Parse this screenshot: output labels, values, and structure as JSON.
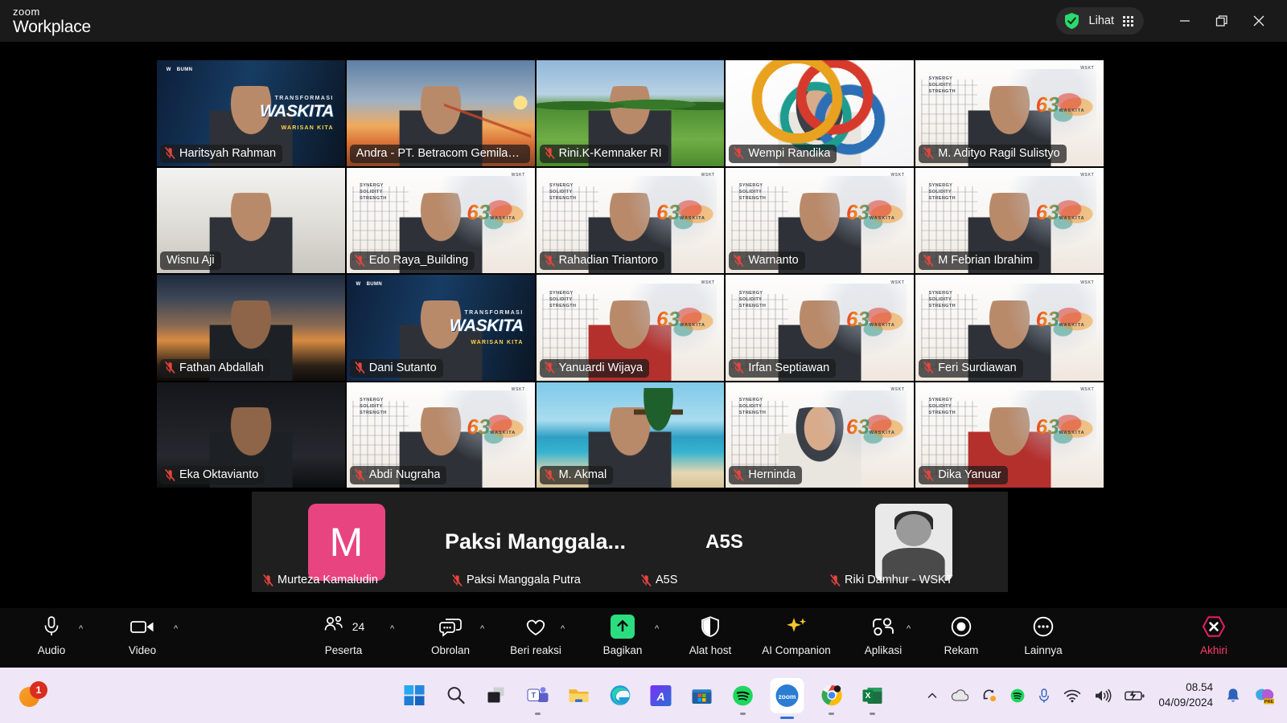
{
  "app": {
    "brand_top": "zoom",
    "brand_bottom": "Workplace"
  },
  "titlebar": {
    "view_label": "Lihat",
    "minimize_label": "—",
    "restore_label": "❐",
    "close_label": "✕"
  },
  "gallery": {
    "participants": [
      {
        "name": "Haritsyah Rahman",
        "muted": true,
        "bg": "bg-transformasi",
        "row": 1
      },
      {
        "name": "Andra - PT. Betracom Gemilang...",
        "muted": false,
        "bg": "bg-bridge",
        "row": 1,
        "active": true
      },
      {
        "name": "Rini.K-Kemnaker RI",
        "muted": true,
        "bg": "bg-field",
        "row": 1
      },
      {
        "name": "Wempi Randika",
        "muted": true,
        "bg": "bg-rings",
        "row": 1
      },
      {
        "name": "M. Adityo Ragil Sulistyo",
        "muted": true,
        "bg": "bg-waskita63",
        "row": 1
      },
      {
        "name": "Wisnu Aji",
        "muted": false,
        "bg": "bg-room",
        "row": 2
      },
      {
        "name": "Edo Raya_Building",
        "muted": true,
        "bg": "bg-waskita63",
        "row": 2
      },
      {
        "name": "Rahadian Triantoro",
        "muted": true,
        "bg": "bg-waskita63",
        "row": 2
      },
      {
        "name": "Warnanto",
        "muted": true,
        "bg": "bg-waskita63",
        "row": 2
      },
      {
        "name": "M Febrian Ibrahim",
        "muted": true,
        "bg": "bg-waskita63",
        "row": 2
      },
      {
        "name": "Fathan Abdallah",
        "muted": true,
        "bg": "bg-sunset",
        "row": 3
      },
      {
        "name": "Dani Sutanto",
        "muted": true,
        "bg": "bg-transformasi",
        "row": 3
      },
      {
        "name": "Yanuardi Wijaya",
        "muted": true,
        "bg": "bg-waskita63",
        "row": 3
      },
      {
        "name": "Irfan Septiawan",
        "muted": true,
        "bg": "bg-waskita63",
        "row": 3
      },
      {
        "name": "Feri Surdiawan",
        "muted": true,
        "bg": "bg-waskita63",
        "row": 3
      },
      {
        "name": "Eka Oktavianto",
        "muted": true,
        "bg": "bg-dark",
        "row": 4
      },
      {
        "name": "Abdi Nugraha",
        "muted": true,
        "bg": "bg-waskita63",
        "row": 4
      },
      {
        "name": "M. Akmal",
        "muted": true,
        "bg": "bg-beach",
        "row": 4
      },
      {
        "name": "Herninda",
        "muted": true,
        "bg": "bg-waskita63",
        "row": 4
      },
      {
        "name": "Dika Yanuar",
        "muted": true,
        "bg": "bg-waskita63",
        "row": 4
      }
    ]
  },
  "strip": {
    "cells": [
      {
        "name": "Murteza Kamaludin",
        "muted": true,
        "kind": "initial",
        "initial": "M",
        "color": "#e8447f"
      },
      {
        "name": "Paksi Manggala Putra",
        "muted": true,
        "kind": "text",
        "text": "Paksi  Manggala..."
      },
      {
        "name": "A5S",
        "muted": true,
        "kind": "text",
        "text": "A5S"
      },
      {
        "name": "Riki Damhur - WSKT",
        "muted": true,
        "kind": "photo"
      }
    ]
  },
  "controls": [
    {
      "id": "audio",
      "label": "Audio",
      "icon": "microphone-icon",
      "caret": true
    },
    {
      "id": "video",
      "label": "Video",
      "icon": "camera-icon",
      "caret": true
    },
    {
      "id": "participants",
      "label": "Peserta",
      "icon": "people-icon",
      "caret": true,
      "count": "24"
    },
    {
      "id": "chat",
      "label": "Obrolan",
      "icon": "chat-icon",
      "caret": true
    },
    {
      "id": "reactions",
      "label": "Beri reaksi",
      "icon": "heart-icon",
      "caret": true
    },
    {
      "id": "share",
      "label": "Bagikan",
      "icon": "share-screen-icon",
      "caret": true
    },
    {
      "id": "hosttools",
      "label": "Alat host",
      "icon": "shield-icon",
      "caret": false
    },
    {
      "id": "aicompanion",
      "label": "AI Companion",
      "icon": "sparkle-icon",
      "caret": false
    },
    {
      "id": "apps",
      "label": "Aplikasi",
      "icon": "apps-icon",
      "caret": true
    },
    {
      "id": "record",
      "label": "Rekam",
      "icon": "record-icon",
      "caret": false
    },
    {
      "id": "more",
      "label": "Lainnya",
      "icon": "ellipsis-icon",
      "caret": false
    },
    {
      "id": "end",
      "label": "Akhiri",
      "icon": "end-call-icon",
      "caret": false
    }
  ],
  "taskbar": {
    "notification_count": "1",
    "apps": [
      {
        "name": "start-button",
        "label": "Start"
      },
      {
        "name": "search-icon",
        "label": "Search"
      },
      {
        "name": "task-view-icon",
        "label": "Task View"
      },
      {
        "name": "teams-icon",
        "label": "Microsoft Teams"
      },
      {
        "name": "file-explorer-icon",
        "label": "File Explorer"
      },
      {
        "name": "edge-icon",
        "label": "Microsoft Edge"
      },
      {
        "name": "adobe-icon",
        "label": "Adobe"
      },
      {
        "name": "microsoft-store-icon",
        "label": "Microsoft Store"
      },
      {
        "name": "spotify-icon",
        "label": "Spotify"
      },
      {
        "name": "zoom-icon",
        "label": "Zoom"
      },
      {
        "name": "chrome-icon",
        "label": "Google Chrome"
      },
      {
        "name": "excel-icon",
        "label": "Microsoft Excel"
      }
    ],
    "clock_time": "08.54",
    "clock_date": "04/09/2024",
    "tray_badge": "PRE"
  }
}
